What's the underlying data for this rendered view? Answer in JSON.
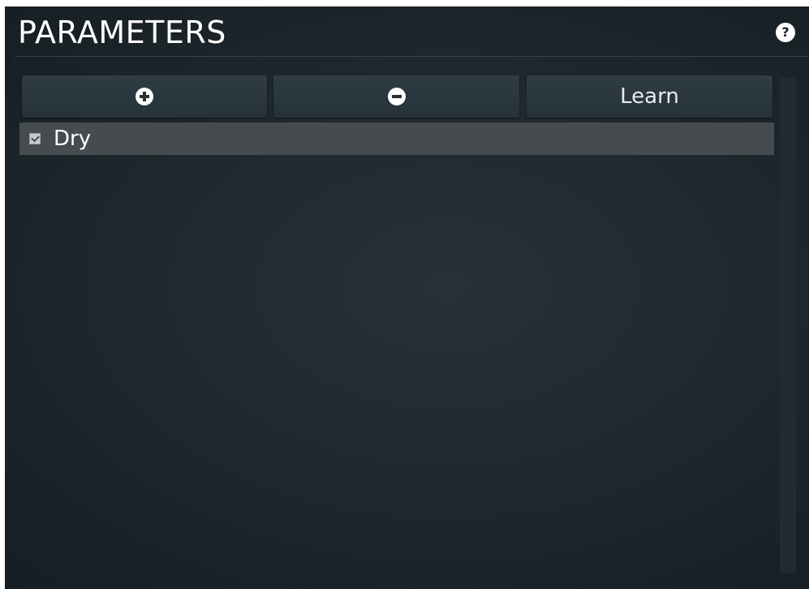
{
  "header": {
    "title": "PARAMETERS",
    "help_label": "?"
  },
  "toolbar": {
    "add_icon": "plus-circle-icon",
    "remove_icon": "minus-circle-icon",
    "learn_label": "Learn"
  },
  "parameters": [
    {
      "label": "Dry",
      "checked": true
    }
  ],
  "colors": {
    "panel_background": "#1f292f",
    "button_background": "#2c3840",
    "row_highlight": "#454b4f",
    "text": "#ffffff"
  }
}
